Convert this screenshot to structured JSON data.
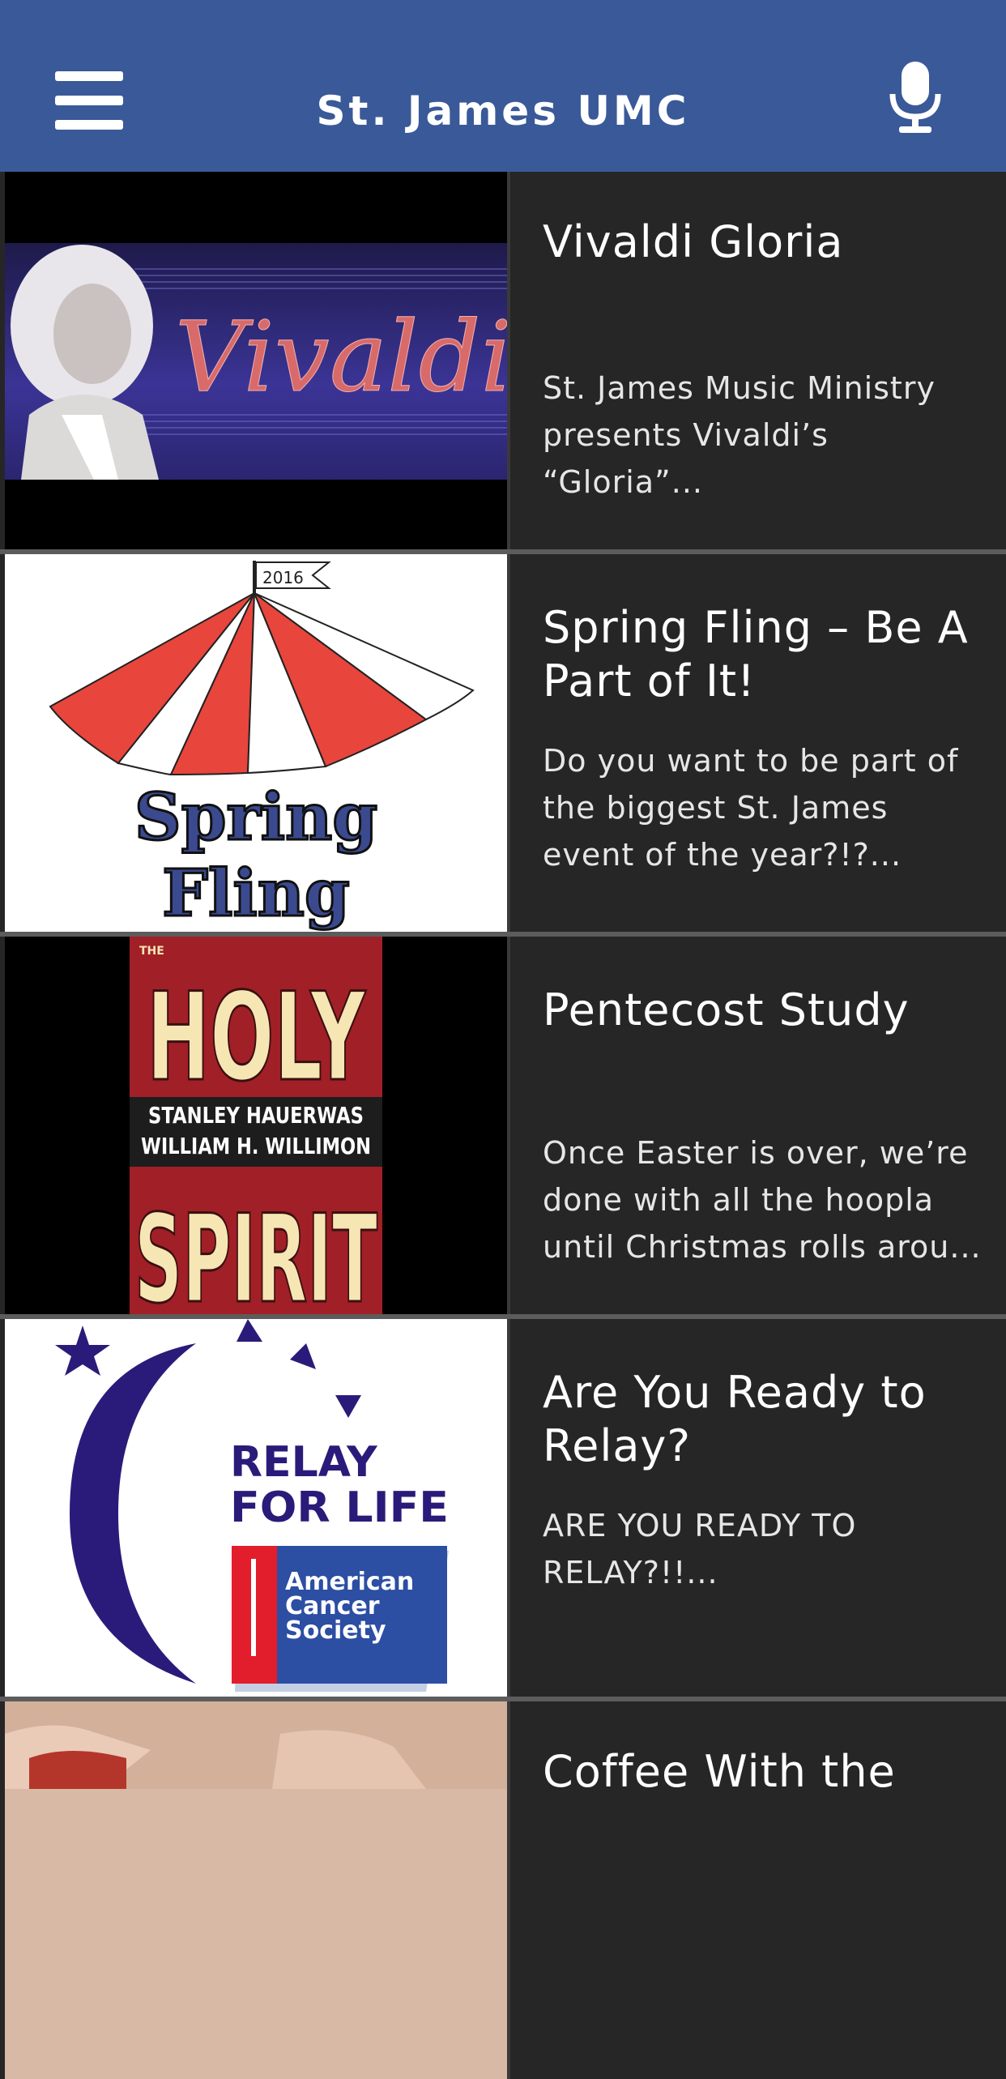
{
  "app": {
    "title": "St. James UMC"
  },
  "header": {
    "menu_icon": "hamburger-icon",
    "mic_icon": "microphone-icon"
  },
  "items": [
    {
      "title": "Vivaldi Gloria",
      "desc": "St. James Music Ministry presents Vivaldi’s “Gloria”...",
      "image_text": "Vivaldi"
    },
    {
      "title": "Spring Fling – Be A Part of It!",
      "desc": "Do you want to be part of the biggest St. James event of the year?!?...",
      "image_text": [
        "2016",
        "Spring",
        "Fling"
      ]
    },
    {
      "title": "Pentecost Study",
      "desc": "Once Easter is over, we’re done with all the hoopla until Christmas rolls arou...",
      "image_text": [
        "THE",
        "HOLY",
        "STANLEY HAUERWAS",
        "WILLIAM H. WILLIMON",
        "SPIRIT"
      ]
    },
    {
      "title": "Are You Ready to Relay?",
      "desc": "ARE YOU READY TO RELAY?!!...",
      "image_text": [
        "RELAY",
        "FOR LIFE",
        "American",
        "Cancer",
        "Society"
      ]
    },
    {
      "title": "Coffee With the",
      "desc": ""
    }
  ]
}
